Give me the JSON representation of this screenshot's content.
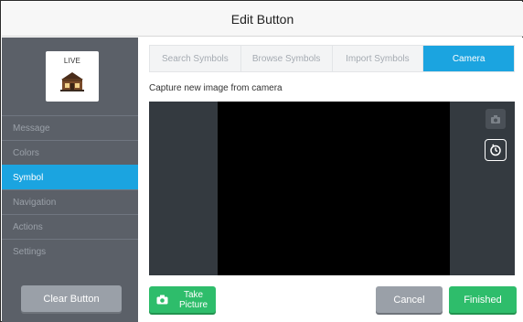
{
  "dialog": {
    "title": "Edit Button"
  },
  "preview": {
    "label": "LIVE",
    "symbol_icon": "house-icon"
  },
  "sidebar": {
    "items": [
      {
        "label": "Message"
      },
      {
        "label": "Colors"
      },
      {
        "label": "Symbol",
        "active": true
      },
      {
        "label": "Navigation"
      },
      {
        "label": "Actions"
      },
      {
        "label": "Settings"
      }
    ],
    "clear_label": "Clear Button"
  },
  "tabs": [
    {
      "label": "Search Symbols"
    },
    {
      "label": "Browse Symbols"
    },
    {
      "label": "Import Symbols"
    },
    {
      "label": "Camera",
      "active": true
    }
  ],
  "camera": {
    "caption": "Capture new image from camera",
    "switch_icon": "camera-switch-icon",
    "timer_icon": "timer-icon"
  },
  "footer": {
    "take_label_line1": "Take",
    "take_label_line2": "Picture",
    "cancel_label": "Cancel",
    "finished_label": "Finished"
  },
  "colors": {
    "accent": "#1ba4e0",
    "success": "#2ebd6b",
    "sidebar": "#5b6068",
    "neutral_button": "#9aa0a8"
  }
}
